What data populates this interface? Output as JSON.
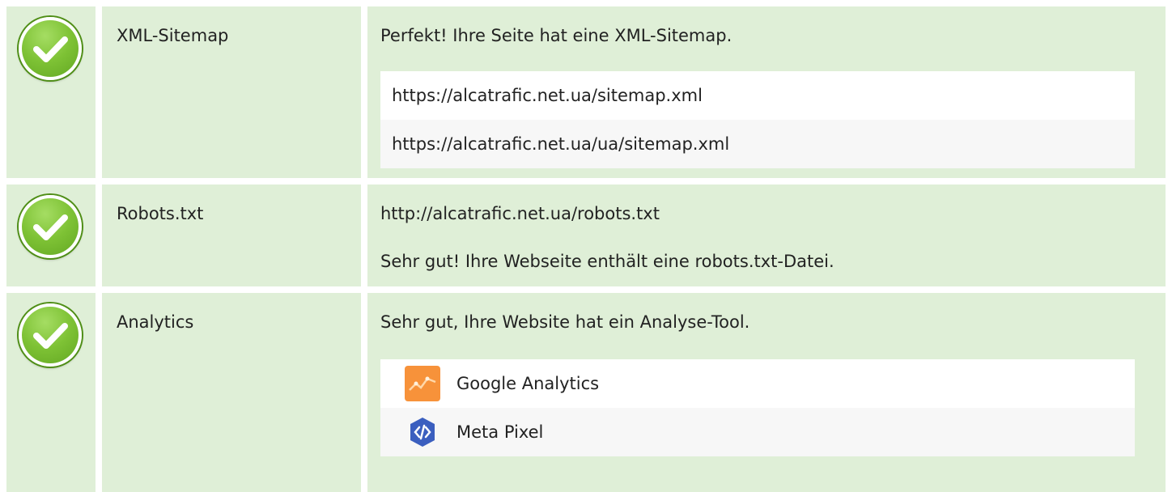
{
  "rows": [
    {
      "label": "XML-Sitemap",
      "status": "check-icon",
      "message": "Perfekt! Ihre Seite hat eine XML-Sitemap.",
      "urls": [
        "https://alcatrafic.net.ua/sitemap.xml",
        "https://alcatrafic.net.ua/ua/sitemap.xml"
      ]
    },
    {
      "label": "Robots.txt",
      "status": "check-icon",
      "url": "http://alcatrafic.net.ua/robots.txt",
      "message": "Sehr gut! Ihre Webseite enthält eine robots.txt-Datei."
    },
    {
      "label": "Analytics",
      "status": "check-icon",
      "message": "Sehr gut, Ihre Website hat ein Analyse-Tool.",
      "tools": [
        {
          "name": "Google Analytics",
          "icon": "google-analytics-icon"
        },
        {
          "name": "Meta Pixel",
          "icon": "meta-pixel-icon"
        }
      ]
    }
  ],
  "colors": {
    "row_background": "#dfefd7",
    "check_green": "#7ec235",
    "analytics_orange": "#f7923a",
    "pixel_blue": "#3b5fbf"
  }
}
